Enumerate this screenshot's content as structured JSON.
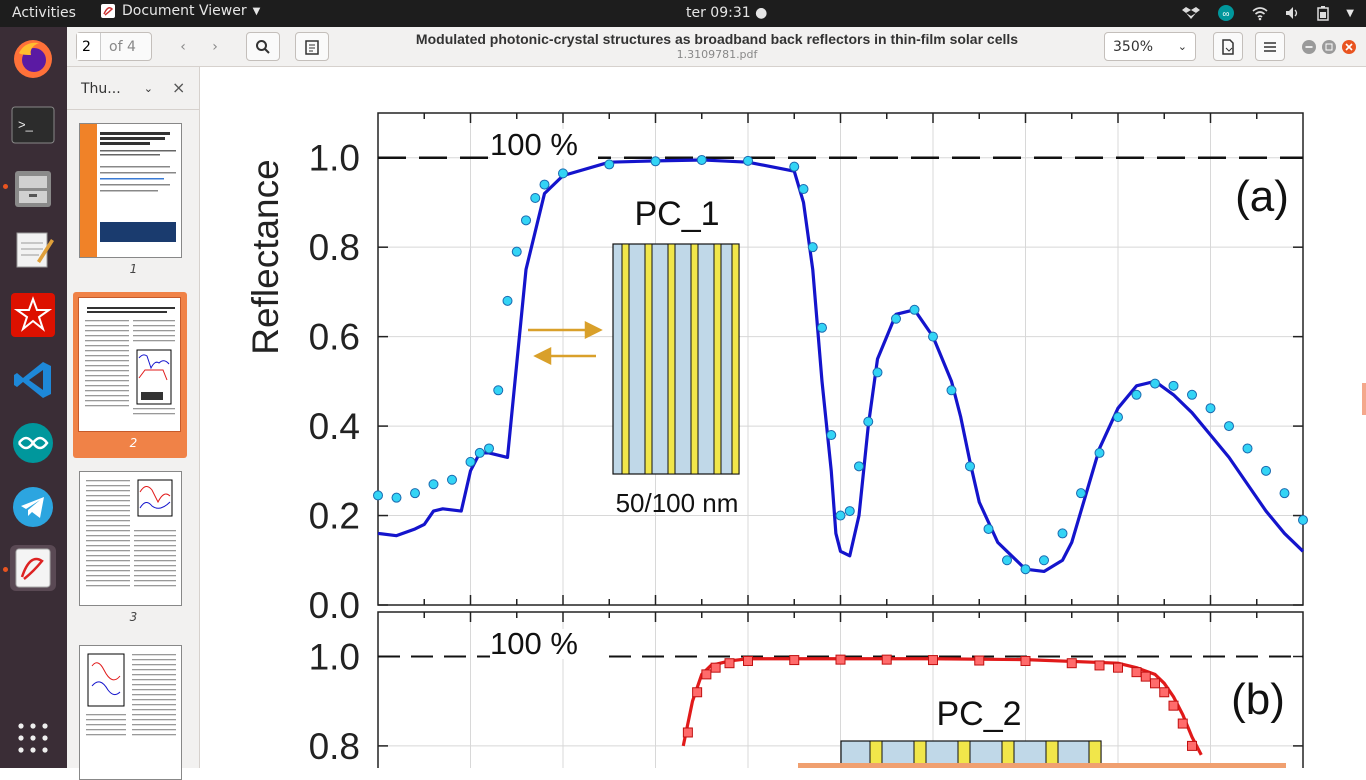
{
  "topbar": {
    "activities": "Activities",
    "app_name": "Document Viewer",
    "clock": "ter 09:31 ●"
  },
  "toolbar": {
    "page_number": "2",
    "page_total": "of 4",
    "zoom": "350%"
  },
  "document": {
    "title": "Modulated photonic-crystal structures as broadband back reflectors in thin-film solar cells",
    "filename": "1.3109781.pdf"
  },
  "sidebar": {
    "mode_label": "Thu...",
    "close": "×",
    "pages": [
      "1",
      "2",
      "3"
    ]
  },
  "figure": {
    "ylabel": "Reflectance",
    "reference_label": "100 %",
    "yticks": [
      "1.0",
      "0.8",
      "0.6",
      "0.4",
      "0.2",
      "0.0"
    ],
    "panel_a": {
      "tag": "(a)",
      "structure": "PC_1",
      "thickness": "50/100 nm"
    },
    "panel_b": {
      "tag": "(b)",
      "structure": "PC_2",
      "yticks": [
        "1.0",
        "0.8"
      ]
    }
  },
  "chart_data": [
    {
      "type": "line",
      "panel": "(a)",
      "ylabel": "Reflectance",
      "ylim": [
        0,
        1.1
      ],
      "xlim": [
        0,
        100
      ],
      "x_tick_labels": "none visible",
      "reference_line": 1.0,
      "series": [
        {
          "name": "",
          "style": "solid line",
          "color": "#1414cc",
          "x": [
            0,
            2,
            4,
            5,
            6,
            7,
            9,
            10,
            11,
            12,
            14,
            16,
            18,
            20,
            25,
            30,
            35,
            40,
            45,
            46,
            47,
            48,
            49,
            49.5,
            50,
            51,
            52,
            53,
            54,
            56,
            58,
            60,
            62,
            63,
            64,
            65,
            67,
            70,
            72,
            74,
            75,
            76,
            77,
            78,
            80,
            82,
            84,
            86,
            88,
            90,
            92,
            94,
            96,
            98,
            100
          ],
          "y": [
            0.16,
            0.155,
            0.17,
            0.18,
            0.21,
            0.215,
            0.21,
            0.3,
            0.34,
            0.34,
            0.33,
            0.75,
            0.92,
            0.96,
            0.99,
            0.993,
            0.995,
            0.99,
            0.97,
            0.9,
            0.75,
            0.5,
            0.3,
            0.16,
            0.12,
            0.11,
            0.2,
            0.4,
            0.55,
            0.65,
            0.66,
            0.6,
            0.5,
            0.42,
            0.32,
            0.23,
            0.14,
            0.08,
            0.075,
            0.1,
            0.14,
            0.21,
            0.28,
            0.35,
            0.44,
            0.49,
            0.5,
            0.47,
            0.43,
            0.38,
            0.33,
            0.27,
            0.21,
            0.16,
            0.12
          ]
        },
        {
          "name": "",
          "style": "circle markers",
          "color": "#33d4f5",
          "x": [
            0,
            2,
            4,
            6,
            8,
            10,
            11,
            12,
            13,
            14,
            15,
            16,
            17,
            18,
            20,
            25,
            30,
            35,
            40,
            45,
            46,
            47,
            48,
            49,
            50,
            51,
            52,
            53,
            54,
            56,
            58,
            60,
            62,
            64,
            66,
            68,
            70,
            72,
            74,
            76,
            78,
            80,
            82,
            84,
            86,
            88,
            90,
            92,
            94,
            96,
            98,
            100
          ],
          "y": [
            0.245,
            0.24,
            0.25,
            0.27,
            0.28,
            0.32,
            0.34,
            0.35,
            0.48,
            0.68,
            0.79,
            0.86,
            0.91,
            0.94,
            0.965,
            0.985,
            0.992,
            0.995,
            0.993,
            0.98,
            0.93,
            0.8,
            0.62,
            0.38,
            0.2,
            0.21,
            0.31,
            0.41,
            0.52,
            0.64,
            0.66,
            0.6,
            0.48,
            0.31,
            0.17,
            0.1,
            0.08,
            0.1,
            0.16,
            0.25,
            0.34,
            0.42,
            0.47,
            0.495,
            0.49,
            0.47,
            0.44,
            0.4,
            0.35,
            0.3,
            0.25,
            0.19
          ]
        }
      ]
    },
    {
      "type": "line",
      "panel": "(b)",
      "ylim": [
        0.8,
        1.1
      ],
      "xlim": [
        0,
        100
      ],
      "reference_line": 1.0,
      "series": [
        {
          "name": "",
          "style": "solid line",
          "color": "#e11a1a",
          "x": [
            33,
            34,
            35,
            36,
            38,
            40,
            50,
            60,
            70,
            80,
            82,
            84,
            85,
            86,
            87,
            88,
            89
          ],
          "y": [
            0.8,
            0.9,
            0.96,
            0.98,
            0.99,
            0.995,
            0.995,
            0.995,
            0.993,
            0.985,
            0.975,
            0.96,
            0.94,
            0.91,
            0.87,
            0.82,
            0.78
          ]
        },
        {
          "name": "",
          "style": "square markers",
          "color": "#ff6b6b",
          "x": [
            33.5,
            34.5,
            35.5,
            36.5,
            38,
            40,
            45,
            50,
            55,
            60,
            65,
            70,
            75,
            78,
            80,
            82,
            83,
            84,
            85,
            86,
            87,
            88
          ],
          "y": [
            0.83,
            0.92,
            0.96,
            0.975,
            0.985,
            0.99,
            0.992,
            0.993,
            0.993,
            0.992,
            0.991,
            0.99,
            0.985,
            0.98,
            0.975,
            0.965,
            0.955,
            0.94,
            0.92,
            0.89,
            0.85,
            0.8
          ]
        }
      ]
    }
  ]
}
